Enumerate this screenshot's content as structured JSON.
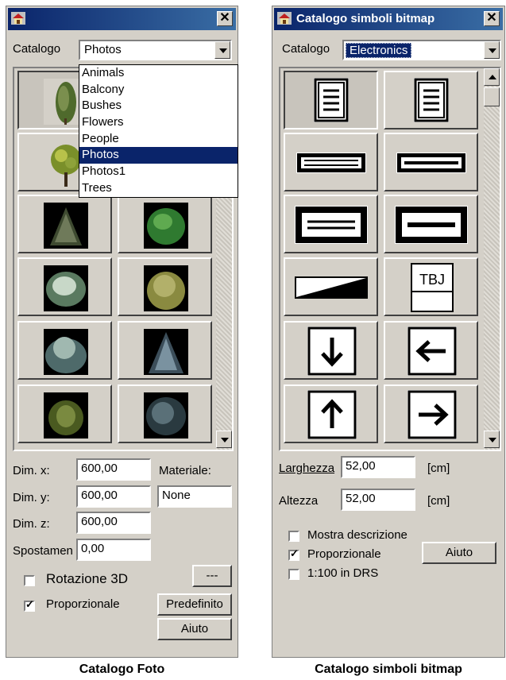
{
  "left_window": {
    "title": "",
    "close_label": "✕",
    "catalog_label": "Catalogo",
    "catalog_value": "Photos",
    "dropdown_options": [
      "Animals",
      "Balcony",
      "Bushes",
      "Flowers",
      "People",
      "Photos",
      "Photos1",
      "Trees"
    ],
    "dropdown_selected": "Photos",
    "dim_x_label": "Dim. x:",
    "dim_x_value": "600,00",
    "dim_y_label": "Dim. y:",
    "dim_y_value": "600,00",
    "dim_z_label": "Dim. z:",
    "dim_z_value": "600,00",
    "spostamento_label": "Spostamen",
    "spostamento_value": "0,00",
    "materiale_label": "Materiale:",
    "materiale_value": "None",
    "rotazione_label": "Rotazione 3D",
    "rotazione_checked": false,
    "dots_button": "---",
    "proporzionale_label": "Proporzionale",
    "proporzionale_checked": true,
    "predefinito_button": "Predefinito",
    "aiuto_button": "Aiuto",
    "caption": "Catalogo Foto"
  },
  "right_window": {
    "title": "Catalogo simboli bitmap",
    "close_label": "✕",
    "catalog_label": "Catalogo",
    "catalog_value": "Electronics",
    "larghezza_label": "Larghezza",
    "larghezza_value": "52,00",
    "larghezza_unit": "[cm]",
    "altezza_label": "Altezza",
    "altezza_value": "52,00",
    "altezza_unit": "[cm]",
    "mostra_label": "Mostra descrizione",
    "mostra_checked": false,
    "proporzionale_label": "Proporzionale",
    "proporzionale_checked": true,
    "scale_label": "1:100 in DRS",
    "scale_checked": false,
    "aiuto_button": "Aiuto",
    "symbol_text": "TBJ",
    "caption": "Catalogo simboli bitmap"
  },
  "colors": {
    "title_bar": "#0a246a",
    "window_bg": "#d4d0c8",
    "selection": "#0a246a"
  }
}
